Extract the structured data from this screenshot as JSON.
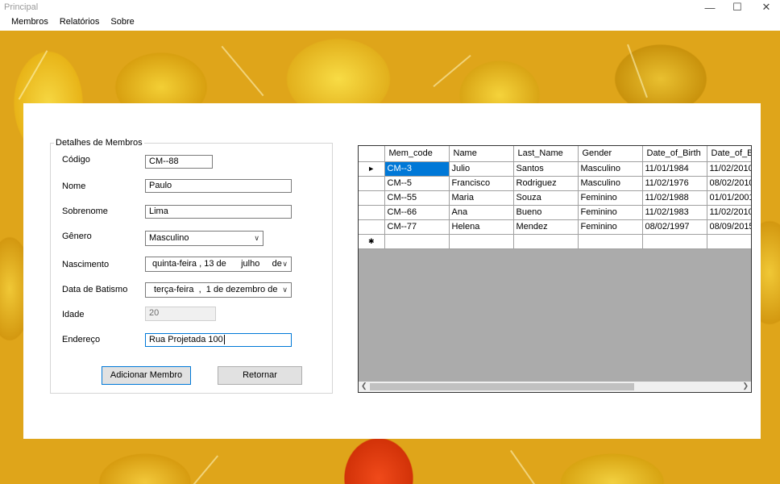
{
  "window": {
    "title": "Principal"
  },
  "menu": [
    "Membros",
    "Relatórios",
    "Sobre"
  ],
  "form": {
    "group_title": "Detalhes de Membros",
    "labels": {
      "codigo": "Código",
      "nome": "Nome",
      "sobrenome": "Sobrenome",
      "genero": "Gênero",
      "nascimento": "Nascimento",
      "batismo": "Data de Batismo",
      "idade": "Idade",
      "endereco": "Endereço"
    },
    "values": {
      "codigo": "CM--88",
      "nome": "Paulo",
      "sobrenome": "Lima",
      "genero": "Masculino",
      "nascimento": "quinta-feira , 13 de      julho     de",
      "batismo": "terça-feira  ,  1 de dezembro de",
      "idade": "20",
      "endereco": "Rua Projetada 100"
    },
    "buttons": {
      "add": "Adicionar Membro",
      "back": "Retornar"
    }
  },
  "grid": {
    "columns": [
      "Mem_code",
      "Name",
      "Last_Name",
      "Gender",
      "Date_of_Birth",
      "Date_of_B"
    ],
    "rows": [
      [
        "CM--3",
        "Julio",
        "Santos",
        "Masculino",
        "11/01/1984",
        "11/02/2010"
      ],
      [
        "CM--5",
        "Francisco",
        "Rodriguez",
        "Masculino",
        "11/02/1976",
        "08/02/2010"
      ],
      [
        "CM--55",
        "Maria",
        "Souza",
        "Feminino",
        "11/02/1988",
        "01/01/2001"
      ],
      [
        "CM--66",
        "Ana",
        "Bueno",
        "Feminino",
        "11/02/1983",
        "11/02/2010"
      ],
      [
        "CM--77",
        "Helena",
        "Mendez",
        "Feminino",
        "08/02/1997",
        "08/09/2015"
      ]
    ],
    "current_row_marker": "►",
    "new_row_marker": "✱"
  }
}
